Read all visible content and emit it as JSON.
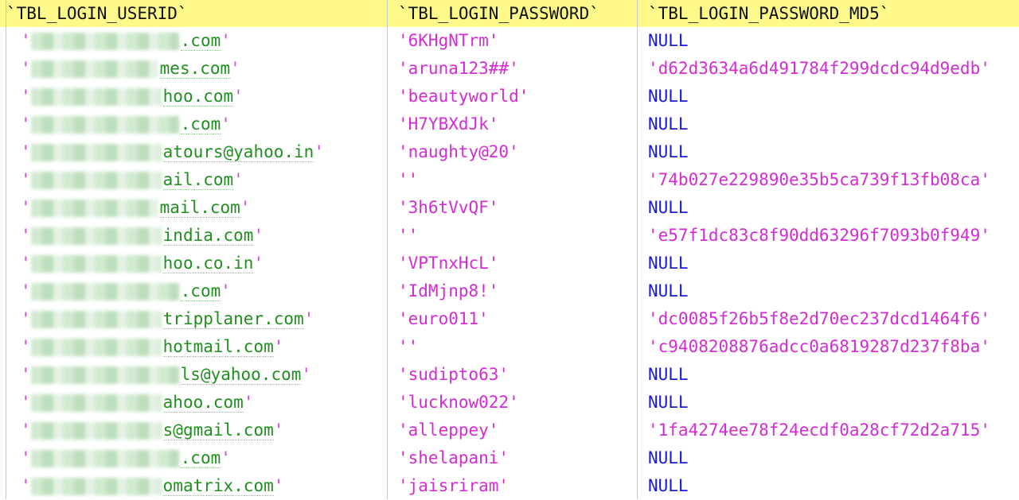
{
  "columns": [
    {
      "label": "`TBL_LOGIN_USERID`"
    },
    {
      "label": "`TBL_LOGIN_PASSWORD`"
    },
    {
      "label": "`TBL_LOGIN_PASSWORD_MD5`"
    }
  ],
  "rows": [
    {
      "user_visible": ".com",
      "password": "'6KHgNTrm'",
      "md5": "NULL"
    },
    {
      "user_visible": "mes.com",
      "password": "'aruna123##'",
      "md5": "'d62d3634a6d491784f299dcdc94d9edb'"
    },
    {
      "user_visible": "hoo.com",
      "password": "'beautyworld'",
      "md5": "NULL"
    },
    {
      "user_visible": ".com",
      "password": "'H7YBXdJk'",
      "md5": "NULL"
    },
    {
      "user_visible": "atours@yahoo.in",
      "password": "'naughty@20'",
      "md5": "NULL"
    },
    {
      "user_visible": "ail.com",
      "password": "''",
      "md5": "'74b027e229890e35b5ca739f13fb08ca'"
    },
    {
      "user_visible": "mail.com",
      "password": "'3h6tVvQF'",
      "md5": "NULL"
    },
    {
      "user_visible": "india.com",
      "password": "''",
      "md5": "'e57f1dc83c8f90dd63296f7093b0f949'"
    },
    {
      "user_visible": "hoo.co.in",
      "password": "'VPTnxHcL'",
      "md5": "NULL"
    },
    {
      "user_visible": ".com",
      "password": "'IdMjnp8!'",
      "md5": "NULL"
    },
    {
      "user_visible": "tripplaner.com",
      "password": "'euro011'",
      "md5": "'dc0085f26b5f8e2d70ec237dcd1464f6'"
    },
    {
      "user_visible": "hotmail.com",
      "password": "''",
      "md5": "'c9408208876adcc0a6819287d237f8ba'"
    },
    {
      "user_visible": "ls@yahoo.com",
      "password": "'sudipto63'",
      "md5": "NULL"
    },
    {
      "user_visible": "ahoo.com",
      "password": "'lucknow022'",
      "md5": "NULL"
    },
    {
      "user_visible": "s@gmail.com",
      "password": "'alleppey'",
      "md5": "'1fa4274ee78f24ecdf0a28cf72d2a715'"
    },
    {
      "user_visible": ".com",
      "password": "'shelapani'",
      "md5": "NULL"
    },
    {
      "user_visible": "omatrix.com",
      "password": "'jaisriram'",
      "md5": "NULL"
    }
  ],
  "quote_char": "'"
}
